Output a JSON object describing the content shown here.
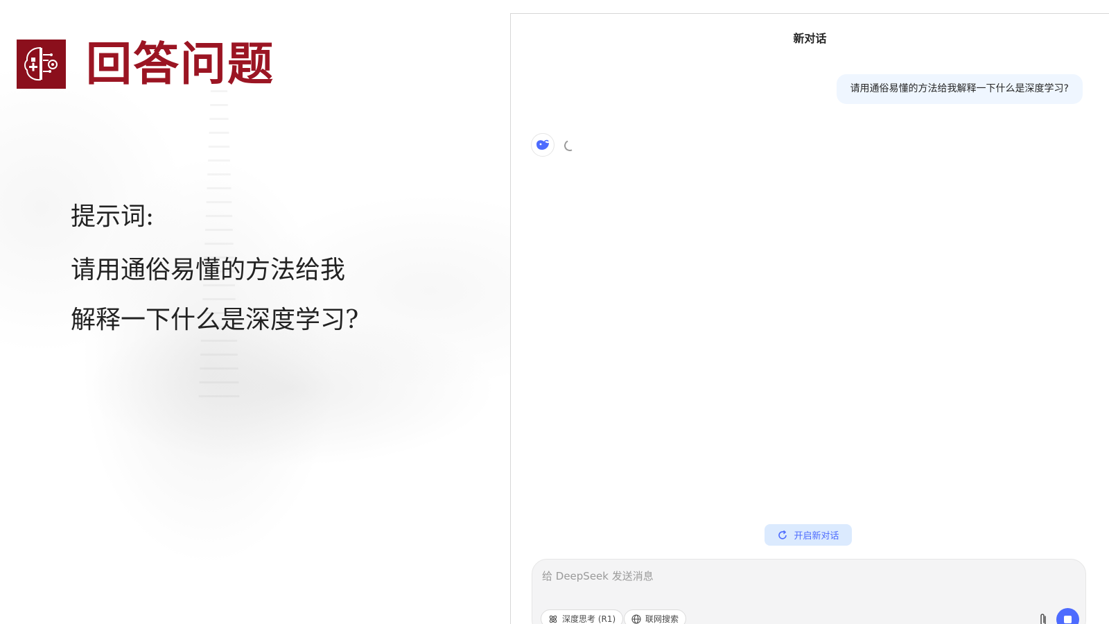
{
  "slide": {
    "title": "回答问题",
    "prompt_label": "提示词:",
    "prompt_text": "请用通俗易懂的方法给我解释一下什么是深度学习?"
  },
  "chat": {
    "title": "新对话",
    "user_message": "请用通俗易懂的方法给我解释一下什么是深度学习?",
    "new_chat_label": "开启新对话",
    "input_placeholder": "给 DeepSeek 发送消息",
    "deep_think_label": "深度思考 (R1)",
    "web_search_label": "联网搜索"
  },
  "colors": {
    "brand_red": "#9b1523",
    "accent_blue": "#4d6bfe",
    "user_bubble": "#eff6ff"
  },
  "icons": {
    "logo": "brain-gear-icon",
    "bot": "whale-icon",
    "new_chat": "refresh-chat-icon",
    "deep_think": "atom-icon",
    "web_search": "globe-icon",
    "attach": "paperclip-icon",
    "stop": "stop-icon"
  }
}
